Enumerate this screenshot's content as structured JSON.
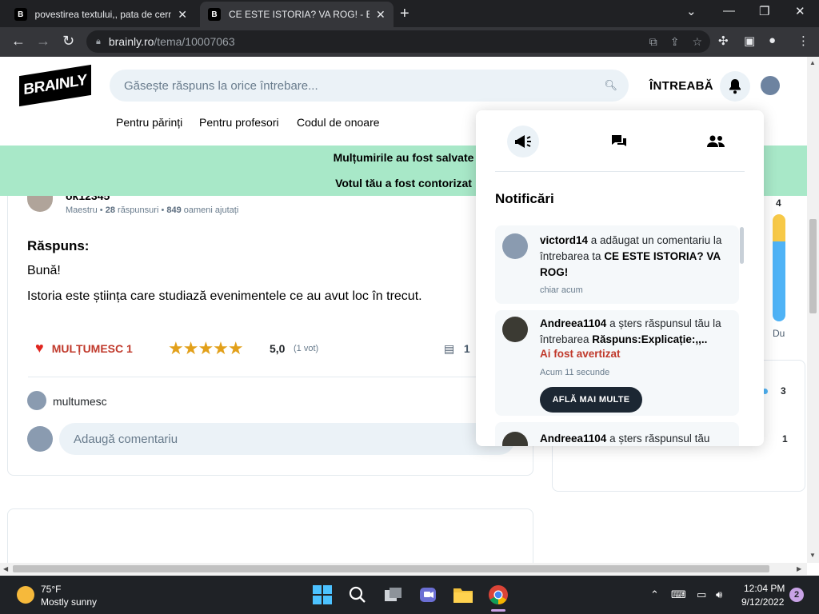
{
  "browser": {
    "tabs": [
      {
        "favicon": "B",
        "title": "povestirea textului,, pata de cerne"
      },
      {
        "favicon": "B",
        "title": "CE ESTE ISTORIA? VA ROG! - Brai"
      }
    ],
    "url_host": "brainly.ro",
    "url_path": "/tema/10007063"
  },
  "header": {
    "logo": "BRAINLY",
    "search_placeholder": "Găsește răspuns la orice întrebare...",
    "ask_label": "ÎNTREABĂ",
    "nav": [
      "Pentru părinți",
      "Pentru profesori",
      "Codul de onoare"
    ]
  },
  "banner": {
    "line1": "Mulțumirile au fost salvate",
    "line2": "Votul tău a fost contorizat"
  },
  "answer": {
    "username": "ok12345",
    "rank": "Maestru",
    "answers_count": "28",
    "answers_label": "răspunsuri",
    "helped_count": "849",
    "helped_label": "oameni ajutați",
    "heading": "Răspuns:",
    "greeting": "Bună!",
    "body": "Istoria este știința care studiază evenimentele ce au avut loc în trecut.",
    "thanks_label": "MULȚUMESC 1",
    "stars": "★★★★★",
    "rating": "5,0",
    "votes": "(1 vot)",
    "comments_count": "1"
  },
  "comment": {
    "user_comment": "multumesc",
    "input_placeholder": "Adaugă comentariu"
  },
  "right_panel": {
    "rank_num_top": "4",
    "du_label": "Du",
    "rank_num_mid": "3",
    "rank_num_low": "1"
  },
  "notifications": {
    "title": "Notificări",
    "items": [
      {
        "user": "victord14",
        "action": " a adăugat un comentariu la întrebarea ta ",
        "target": "CE ESTE ISTORIA? VA ROG!",
        "time": "chiar acum"
      },
      {
        "user": "Andreea1104",
        "action": " a șters răspunsul tău la întrebarea ",
        "target": "Răspuns:Explicație:,,..",
        "warning": "Ai fost avertizat",
        "time": "Acum 11 secunde",
        "button": "AFLĂ MAI MULTE"
      },
      {
        "user": "Andreea1104",
        "action": " a șters răspunsul tău"
      }
    ]
  },
  "taskbar": {
    "temperature": "75°F",
    "weather": "Mostly sunny",
    "time": "12:04 PM",
    "date": "9/12/2022",
    "notification_count": "2"
  },
  "colors": {
    "banner_bg": "#a8e8c8",
    "accent_red": "#c0392b",
    "star": "#e2a01a",
    "button_dark": "#1c2733",
    "input_bg": "#ebf2f7"
  }
}
